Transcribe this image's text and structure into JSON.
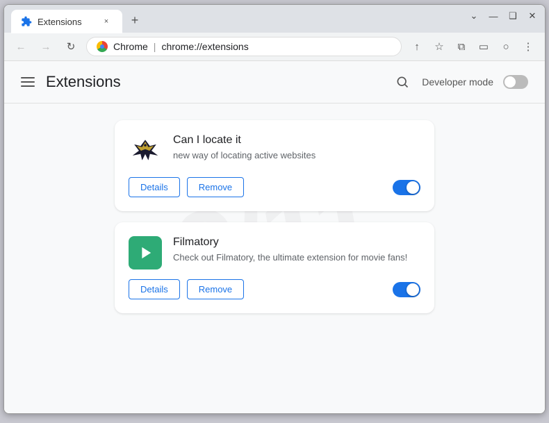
{
  "browser": {
    "tab": {
      "title": "Extensions",
      "close_label": "×",
      "new_tab_label": "+"
    },
    "window_controls": {
      "minimize": "—",
      "maximize": "❑",
      "close": "✕",
      "chevron": "⌄"
    },
    "address_bar": {
      "brand": "Chrome",
      "separator": "|",
      "url": "chrome://extensions"
    },
    "nav_buttons": {
      "back": "←",
      "forward": "→",
      "reload": "↻",
      "share": "↑",
      "bookmark": "☆",
      "extensions": "⧉",
      "sidebar": "▭",
      "profile": "○",
      "menu": "⋮"
    }
  },
  "extensions_page": {
    "header": {
      "title": "Extensions",
      "hamburger_label": "menu",
      "search_label": "search",
      "dev_mode_label": "Developer mode",
      "dev_mode_enabled": false
    },
    "extensions": [
      {
        "id": "can-i-locate-it",
        "name": "Can I locate it",
        "description": "new way of locating active websites",
        "enabled": true,
        "details_label": "Details",
        "remove_label": "Remove",
        "icon_type": "bird"
      },
      {
        "id": "filmatory",
        "name": "Filmatory",
        "description": "Check out Filmatory, the ultimate extension for movie fans!",
        "enabled": true,
        "details_label": "Details",
        "remove_label": "Remove",
        "icon_type": "film"
      }
    ]
  }
}
